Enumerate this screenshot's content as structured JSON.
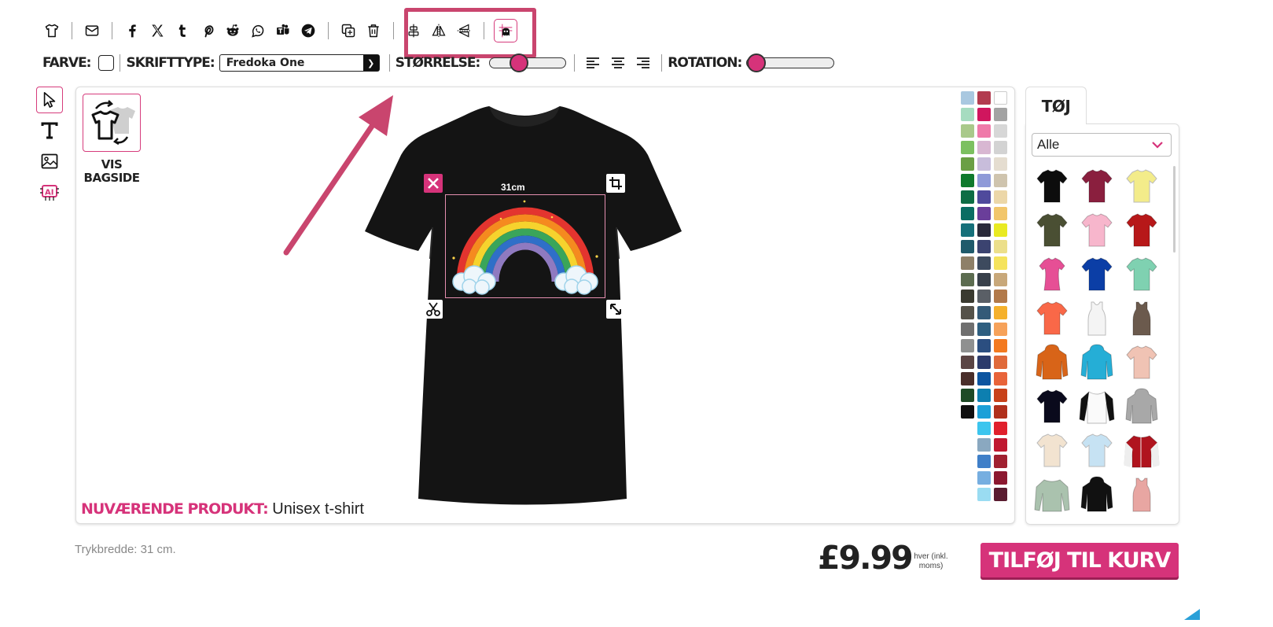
{
  "toolbar": {
    "icons": [
      "tshirt-icon",
      "mail-icon",
      "facebook-icon",
      "x-icon",
      "tumblr-icon",
      "pinterest-icon",
      "reddit-icon",
      "whatsapp-icon",
      "teams-icon",
      "telegram-icon",
      "copy-icon",
      "trash-icon",
      "center-icon",
      "flip-horizontal-icon",
      "flip-vertical-icon",
      "grid-ghost-icon"
    ]
  },
  "options": {
    "color_label": "FARVE:",
    "font_label": "SKRIFTTYPE:",
    "font_value": "Fredoka One",
    "size_label": "STØRRELSE:",
    "size_value": 0.35,
    "rotation_label": "ROTATION:",
    "rotation_value": 0.0
  },
  "canvas": {
    "back_label_1": "VIS",
    "back_label_2": "BAGSIDE",
    "dimension": "31cm",
    "current_product_label": "NUVÆRENDE PRODUKT:",
    "current_product_value": "Unisex t-shirt",
    "tee_color": "#141414"
  },
  "palette": [
    "#a9c8e0",
    "#b23b4f",
    "#ffffff",
    "#a6dcc0",
    "#d0165e",
    "#a3a3a3",
    "#a9c98a",
    "#ef7aa9",
    "#d7d7d7",
    "#7cc060",
    "#d8b7d2",
    "#d3d3d3",
    "#6a9f45",
    "#c8bddb",
    "#e5ddd0",
    "#0f7a2c",
    "#8f9ad8",
    "#cfc4ae",
    "#0e6d45",
    "#4f4a9c",
    "#ecd7a8",
    "#0a6d63",
    "#6a3e9a",
    "#f2c66b",
    "#16707a",
    "#2a2a3a",
    "#e9ea22",
    "#1f5a6b",
    "#3b4370",
    "#ecdf8a",
    "#8e8068",
    "#3d4a5e",
    "#f5e35c",
    "#5c6c50",
    "#38404a",
    "#c8a87a",
    "#3a3a30",
    "#5a5f66",
    "#b27a4a",
    "#55524a",
    "#345a78",
    "#f5b12c",
    "#6f6f6f",
    "#2f5f80",
    "#f6a25a",
    "#8f9090",
    "#2b4e80",
    "#f37a20",
    "#5a4444",
    "#2b3a6b",
    "#e06a3a",
    "#4a2e2a",
    "#0d55a0",
    "#e8643a",
    "#1e4a26",
    "#0d7fb0",
    "#c8421a",
    "#0f0f0f",
    "#1aa0d8",
    "#b0301c",
    "",
    "#3cc5ee",
    "#e0202c",
    "",
    "#8aa8c0",
    "#c01830",
    "",
    "#3f7fc8",
    "#a02030",
    "",
    "#76aee0",
    "#8c1830",
    "",
    "#9adcf2",
    "#5a1c30"
  ],
  "panel": {
    "tab_label": "TØJ",
    "filter_value": "Alle",
    "products": [
      {
        "color": "#0d0d0d",
        "type": "tee"
      },
      {
        "color": "#8a1f3e",
        "type": "tee"
      },
      {
        "color": "#f3ec8a",
        "type": "tee"
      },
      {
        "color": "#4a4f33",
        "type": "tee"
      },
      {
        "color": "#f7b6cc",
        "type": "tee"
      },
      {
        "color": "#b71819",
        "type": "tee"
      },
      {
        "color": "#e64f95",
        "type": "lady"
      },
      {
        "color": "#0b3ea6",
        "type": "tee"
      },
      {
        "color": "#7fd1b1",
        "type": "tee"
      },
      {
        "color": "#f96848",
        "type": "tee"
      },
      {
        "color": "#f4f4f4",
        "type": "tank"
      },
      {
        "color": "#6b5a4d",
        "type": "tank"
      },
      {
        "color": "#d86418",
        "type": "hoodie"
      },
      {
        "color": "#25aed6",
        "type": "hoodie"
      },
      {
        "color": "#f0c3b4",
        "type": "tee"
      },
      {
        "color": "#0a0a1c",
        "type": "tee"
      },
      {
        "color": "#fafafa",
        "type": "raglan"
      },
      {
        "color": "#a8a8a8",
        "type": "hoodie"
      },
      {
        "color": "#f2e3d0",
        "type": "tee"
      },
      {
        "color": "#c6e2f3",
        "type": "tee"
      },
      {
        "color": "#b0141e",
        "type": "jacket"
      },
      {
        "color": "#aac2ae",
        "type": "long"
      },
      {
        "color": "#111111",
        "type": "hoodie"
      },
      {
        "color": "#e8a6a2",
        "type": "tank"
      }
    ]
  },
  "footer": {
    "print_width": "Trykbredde: 31 cm.",
    "price": "£9.99",
    "price_note": "hver (inkl. moms)",
    "add_to_cart": "TILFØJ TIL KURV"
  }
}
